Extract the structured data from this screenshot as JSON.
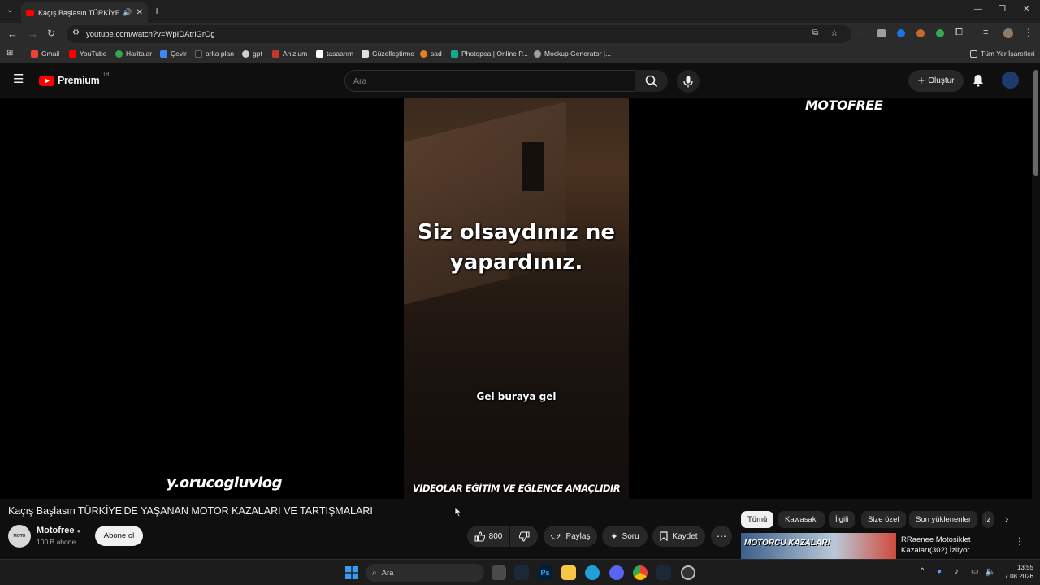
{
  "browser": {
    "tab_title": "Kaçış Başlasın TÜRKİYE'DE Y",
    "url": "youtube.com/watch?v=WpIDAtriGrOg",
    "bookmarks": [
      "Gmail",
      "YouTube",
      "Haritalar",
      "Çevir",
      "arka plan",
      "gpt",
      "Anizium",
      "tasaarım",
      "Güzelleştirme",
      "sad",
      "Photopea | Online P...",
      "Mockup Generator |..."
    ],
    "all_bookmarks": "Tüm Yer İşaretleri"
  },
  "youtube": {
    "logo": "Premium",
    "logo_sup": "TR",
    "search_placeholder": "Ara",
    "create_label": "Oluştur"
  },
  "video": {
    "caption_main": "Siz olsaydınız ne yapardınız.",
    "caption_sub": "Gel buraya gel",
    "watermark_top": "MOTOFREE",
    "watermark_left": "y.orucogluvlog",
    "watermark_bottom": "VİDEOLAR EĞİTİM VE EĞLENCE AMAÇLIDIR"
  },
  "details": {
    "title": "Kaçış Başlasın TÜRKİYE'DE YAŞANAN MOTOR KAZALARI VE TARTIŞMALARI",
    "channel_name": "Motofree",
    "subscribers": "100 B abone",
    "subscribe_label": "Abone ol",
    "like_count": "800",
    "share_label": "Paylaş",
    "ask_label": "Soru",
    "save_label": "Kaydet"
  },
  "chips": [
    "Tümü",
    "Kawasaki",
    "İlgili",
    "Size özel",
    "Son yüklenenler",
    "İz"
  ],
  "recommended": {
    "thumb_text": "MOTORCU KAZALARI",
    "title": "RRaenee Motosiklet Kazaları(302) İzliyor ..."
  },
  "taskbar": {
    "search_label": "Ara",
    "time": "13:55",
    "date": "7.08.2026"
  },
  "colors": {
    "brand_red": "#ff0000",
    "bg": "#0f0f0f",
    "chip_active_bg": "#f1f1f1"
  }
}
